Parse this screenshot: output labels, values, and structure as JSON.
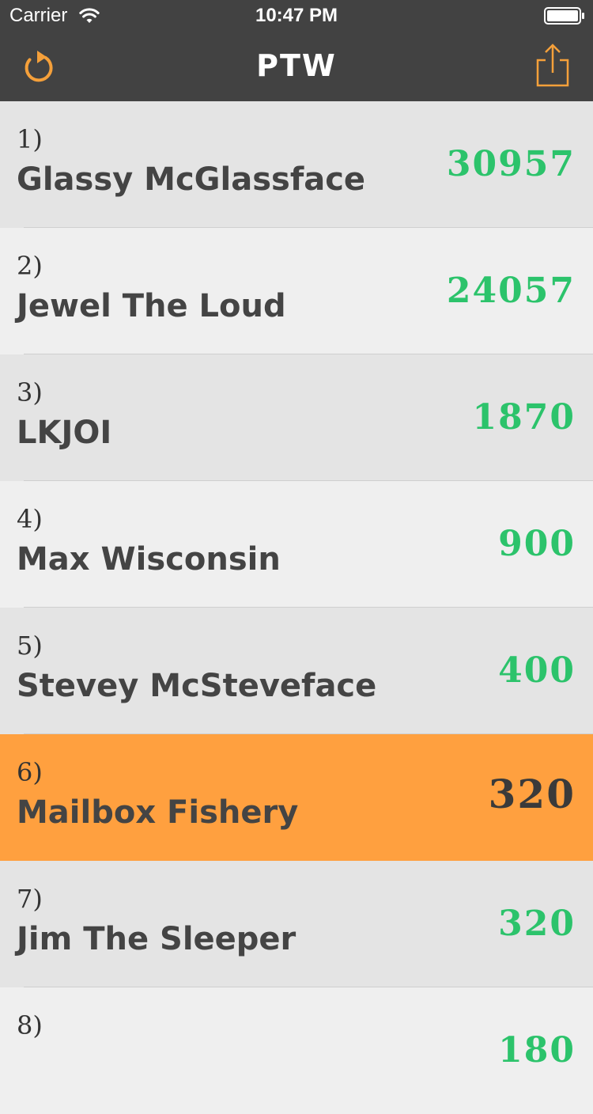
{
  "status_bar": {
    "carrier": "Carrier",
    "time": "10:47 PM",
    "wifi_icon": "wifi-icon",
    "battery_icon": "battery-icon"
  },
  "nav": {
    "title": "PTW",
    "refresh_icon": "refresh-icon",
    "share_icon": "share-icon"
  },
  "colors": {
    "bar_bg": "#424242",
    "accent": "#f5a03a",
    "score_green": "#2cc36b",
    "highlight_row": "#ffa03f",
    "row_odd": "#e4e4e4",
    "row_even": "#efefef",
    "text_dark": "#444444"
  },
  "leaderboard": [
    {
      "rank": "1)",
      "name": "Glassy McGlassface",
      "score": "30957",
      "highlighted": false
    },
    {
      "rank": "2)",
      "name": "Jewel The Loud",
      "score": "24057",
      "highlighted": false
    },
    {
      "rank": "3)",
      "name": "LKJOI",
      "score": "1870",
      "highlighted": false
    },
    {
      "rank": "4)",
      "name": "Max Wisconsin",
      "score": "900",
      "highlighted": false
    },
    {
      "rank": "5)",
      "name": "Stevey McSteveface",
      "score": "400",
      "highlighted": false
    },
    {
      "rank": "6)",
      "name": "Mailbox Fishery",
      "score": "320",
      "highlighted": true
    },
    {
      "rank": "7)",
      "name": "Jim The Sleeper",
      "score": "320",
      "highlighted": false
    },
    {
      "rank": "8)",
      "name": "",
      "score": "180",
      "highlighted": false
    }
  ]
}
